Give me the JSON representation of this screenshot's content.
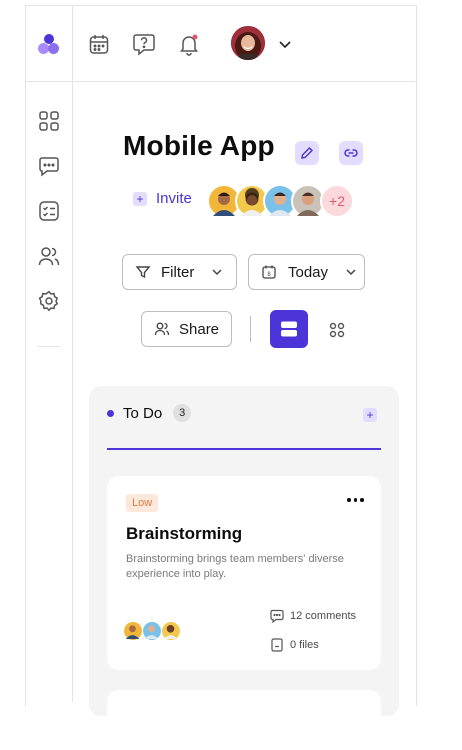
{
  "header": {
    "title": "Mobile App"
  },
  "invite": {
    "label": "Invite",
    "more_count": "+2"
  },
  "toolbar": {
    "filter_label": "Filter",
    "date_label": "Today",
    "share_label": "Share"
  },
  "board": {
    "column": {
      "title": "To Do",
      "count": "3"
    },
    "cards": [
      {
        "priority": "Low",
        "title": "Brainstorming",
        "description": "Brainstorming brings team members' diverse experience into play.",
        "comments": "12 comments",
        "files": "0 files"
      }
    ]
  },
  "colors": {
    "accent": "#4b34d8",
    "accent_light": "#e3dcff",
    "badge_low_bg": "#fde9dc",
    "badge_low_text": "#e0793b"
  },
  "icons": {
    "sidebar": [
      "grid-icon",
      "chat-icon",
      "task-list-icon",
      "users-icon",
      "settings-icon"
    ],
    "topbar": [
      "calendar-icon",
      "help-icon",
      "bell-icon",
      "chevron-down-icon"
    ]
  }
}
